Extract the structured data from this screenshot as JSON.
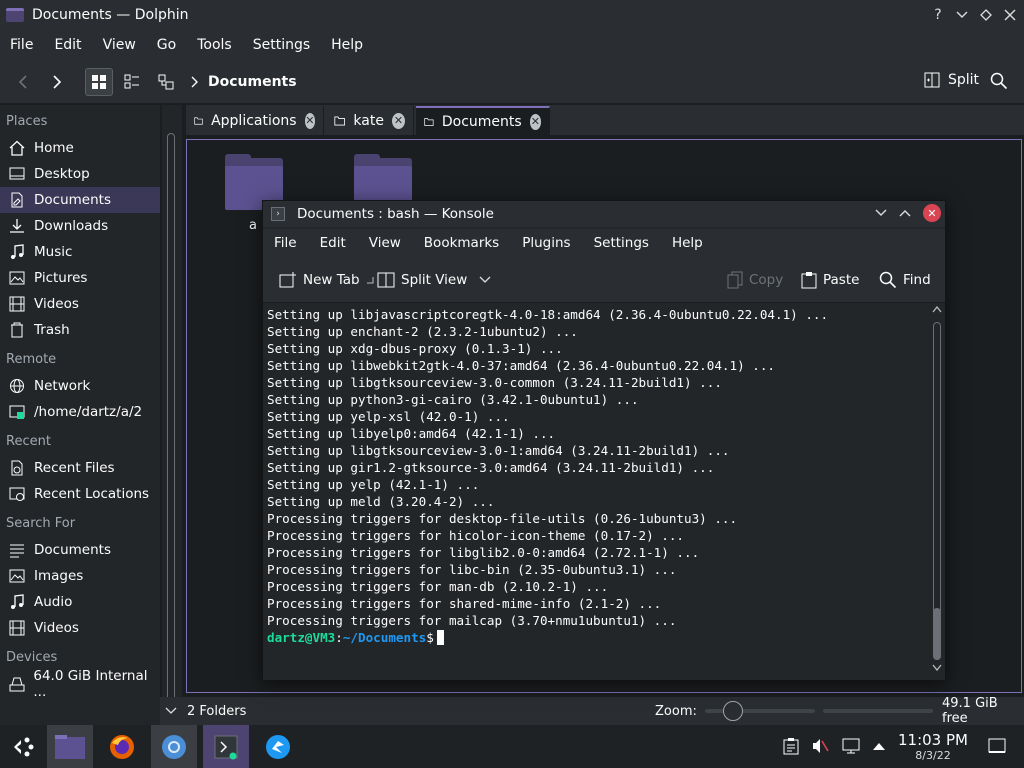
{
  "window": {
    "title": "Documents — Dolphin"
  },
  "menubar": [
    "File",
    "Edit",
    "View",
    "Go",
    "Tools",
    "Settings",
    "Help"
  ],
  "toolbar": {
    "breadcrumb": "Documents",
    "split_label": "Split"
  },
  "sidebar": {
    "sections": [
      {
        "title": "Places",
        "items": [
          {
            "label": "Home",
            "icon": "home-icon"
          },
          {
            "label": "Desktop",
            "icon": "desktop-icon"
          },
          {
            "label": "Documents",
            "icon": "documents-icon",
            "selected": true
          },
          {
            "label": "Downloads",
            "icon": "downloads-icon"
          },
          {
            "label": "Music",
            "icon": "music-icon"
          },
          {
            "label": "Pictures",
            "icon": "pictures-icon"
          },
          {
            "label": "Videos",
            "icon": "videos-icon"
          },
          {
            "label": "Trash",
            "icon": "trash-icon"
          }
        ]
      },
      {
        "title": "Remote",
        "items": [
          {
            "label": "Network",
            "icon": "network-icon"
          },
          {
            "label": "/home/dartz/a/2",
            "icon": "remote-folder-icon"
          }
        ]
      },
      {
        "title": "Recent",
        "items": [
          {
            "label": "Recent Files",
            "icon": "recent-files-icon"
          },
          {
            "label": "Recent Locations",
            "icon": "recent-locations-icon"
          }
        ]
      },
      {
        "title": "Search For",
        "items": [
          {
            "label": "Documents",
            "icon": "search-documents-icon"
          },
          {
            "label": "Images",
            "icon": "images-icon"
          },
          {
            "label": "Audio",
            "icon": "audio-icon"
          },
          {
            "label": "Videos",
            "icon": "search-videos-icon"
          }
        ]
      },
      {
        "title": "Devices",
        "items": [
          {
            "label": "64.0 GiB Internal ...",
            "icon": "drive-icon"
          }
        ]
      }
    ]
  },
  "tabs": [
    {
      "label": "Applications"
    },
    {
      "label": "kate"
    },
    {
      "label": "Documents",
      "active": true
    }
  ],
  "folders": [
    {
      "label": "a"
    },
    {
      "label": ""
    }
  ],
  "statusbar": {
    "count": "2 Folders",
    "zoom_label": "Zoom:",
    "free_space": "49.1 GiB free"
  },
  "konsole": {
    "title": "Documents : bash — Konsole",
    "menu": [
      "File",
      "Edit",
      "View",
      "Bookmarks",
      "Plugins",
      "Settings",
      "Help"
    ],
    "toolbar": {
      "new_tab": "New Tab",
      "split_view": "Split View",
      "copy": "Copy",
      "paste": "Paste",
      "find": "Find"
    },
    "lines": [
      "Setting up libjavascriptcoregtk-4.0-18:amd64 (2.36.4-0ubuntu0.22.04.1) ...",
      "Setting up enchant-2 (2.3.2-1ubuntu2) ...",
      "Setting up xdg-dbus-proxy (0.1.3-1) ...",
      "Setting up libwebkit2gtk-4.0-37:amd64 (2.36.4-0ubuntu0.22.04.1) ...",
      "Setting up libgtksourceview-3.0-common (3.24.11-2build1) ...",
      "Setting up python3-gi-cairo (3.42.1-0ubuntu1) ...",
      "Setting up yelp-xsl (42.0-1) ...",
      "Setting up libyelp0:amd64 (42.1-1) ...",
      "Setting up libgtksourceview-3.0-1:amd64 (3.24.11-2build1) ...",
      "Setting up gir1.2-gtksource-3.0:amd64 (3.24.11-2build1) ...",
      "Setting up yelp (42.1-1) ...",
      "Setting up meld (3.20.4-2) ...",
      "Processing triggers for desktop-file-utils (0.26-1ubuntu3) ...",
      "Processing triggers for hicolor-icon-theme (0.17-2) ...",
      "Processing triggers for libglib2.0-0:amd64 (2.72.1-1) ...",
      "Processing triggers for libc-bin (2.35-0ubuntu3.1) ...",
      "Processing triggers for man-db (2.10.2-1) ...",
      "Processing triggers for shared-mime-info (2.1-2) ...",
      "Processing triggers for mailcap (3.70+nmu1ubuntu1) ..."
    ],
    "prompt": {
      "user": "dartz@VM3",
      "sep": ":",
      "path": "~/Documents",
      "symbol": "$"
    }
  },
  "taskbar": {
    "time": "11:03 PM",
    "date": "8/3/22"
  },
  "colors": {
    "accent": "#7e6fb8",
    "selection": "#3b3756",
    "prompt_user": "#1cdc9a",
    "prompt_path": "#1d99f3",
    "close": "#da4453"
  }
}
